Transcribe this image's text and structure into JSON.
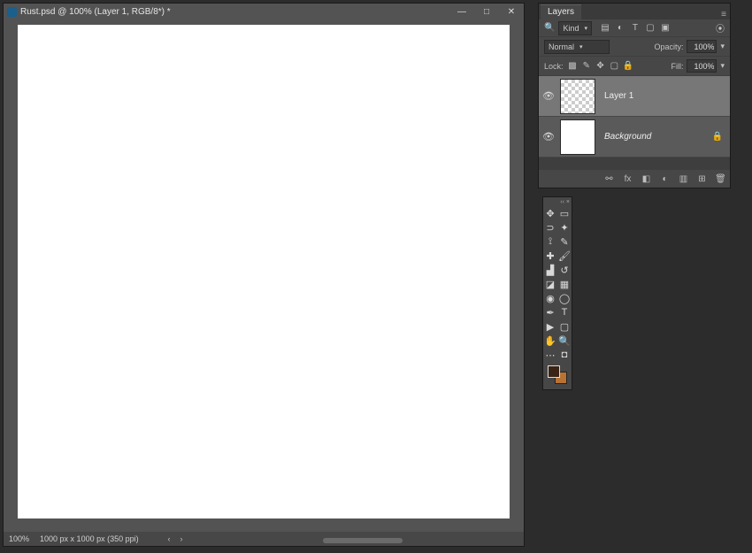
{
  "docwin": {
    "title": "Rust.psd @ 100% (Layer 1, RGB/8*) *",
    "zoom": "100%",
    "dims": "1000 px x 1000 px (350 ppi)",
    "nav_left": "‹",
    "nav_right": "›"
  },
  "layers": {
    "panel_title": "Layers",
    "filter_label": "Kind",
    "blend_mode": "Normal",
    "opacity_label": "Opacity:",
    "opacity_value": "100%",
    "fill_label": "Fill:",
    "fill_value": "100%",
    "lock_label": "Lock:",
    "items": [
      {
        "name": "Layer 1",
        "selected": true,
        "thumb": "transparent",
        "italic": false,
        "locked": false
      },
      {
        "name": "Background",
        "selected": false,
        "thumb": "white",
        "italic": true,
        "locked": true
      }
    ],
    "footer_link": "⊕"
  },
  "tools": {
    "items": [
      "move-tool",
      "rect-marquee-tool",
      "lasso-tool",
      "magic-wand-tool",
      "crop-tool",
      "eyedropper-tool",
      "spot-heal-tool",
      "brush-tool",
      "clone-stamp-tool",
      "history-brush-tool",
      "eraser-tool",
      "gradient-tool",
      "blur-tool",
      "dodge-tool",
      "pen-tool",
      "type-tool",
      "path-select-tool",
      "rectangle-tool",
      "hand-tool",
      "zoom-tool",
      "edit-toolbar",
      "quick-mask"
    ],
    "glyphs": {
      "move-tool": "✥",
      "rect-marquee-tool": "▭",
      "lasso-tool": "⊃",
      "magic-wand-tool": "✦",
      "crop-tool": "⟟",
      "eyedropper-tool": "✎",
      "spot-heal-tool": "✚",
      "brush-tool": "🖌",
      "clone-stamp-tool": "▟",
      "history-brush-tool": "↺",
      "eraser-tool": "◪",
      "gradient-tool": "▦",
      "blur-tool": "◉",
      "dodge-tool": "◯",
      "pen-tool": "✒",
      "type-tool": "T",
      "path-select-tool": "▶",
      "rectangle-tool": "▢",
      "hand-tool": "✋",
      "zoom-tool": "🔍",
      "edit-toolbar": "⋯",
      "quick-mask": "◘"
    },
    "swatch_front": "#3a2416",
    "swatch_back": "#b87333"
  }
}
